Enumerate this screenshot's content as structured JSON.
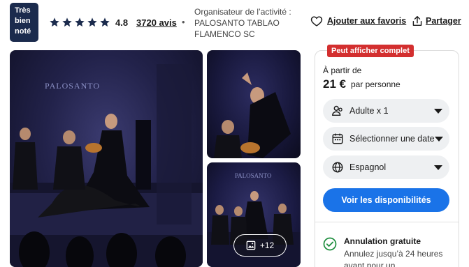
{
  "header": {
    "badge_line1": "Très",
    "badge_line2": "bien",
    "badge_line3": "noté",
    "rating": "4.8",
    "reviews": "3720 avis",
    "separator": "•",
    "organizer_line1": "Organisateur de l’activité :",
    "organizer_line2": "PALOSANTO TABLAO",
    "organizer_line3": "FLAMENCO SC",
    "favorite_label": "Ajouter aux favoris",
    "share_label": "Partager",
    "star_icons": [
      "star-icon",
      "star-icon",
      "star-icon",
      "star-icon",
      "star-icon"
    ]
  },
  "gallery": {
    "more_photos_label": "+12",
    "main_sign": "PALOSANTO",
    "bottom_sign": "PALOSANTO"
  },
  "booking": {
    "flag": "Peut afficher complet",
    "from_label": "À partir de",
    "price": "21 €",
    "per_person": "par personne",
    "participants": "Adulte x 1",
    "date": "Sélectionner une date",
    "language": "Espagnol",
    "cta": "Voir les disponibilités",
    "cancel_title": "Annulation gratuite",
    "cancel_line1": "Annulez jusqu’à 24 heures",
    "cancel_line2": "avant pour un"
  },
  "colors": {
    "badge_bg": "#1b2b4d",
    "cta_blue": "#1a73e8",
    "flag_red": "#d32f2f",
    "check_green": "#1e8e3e"
  }
}
